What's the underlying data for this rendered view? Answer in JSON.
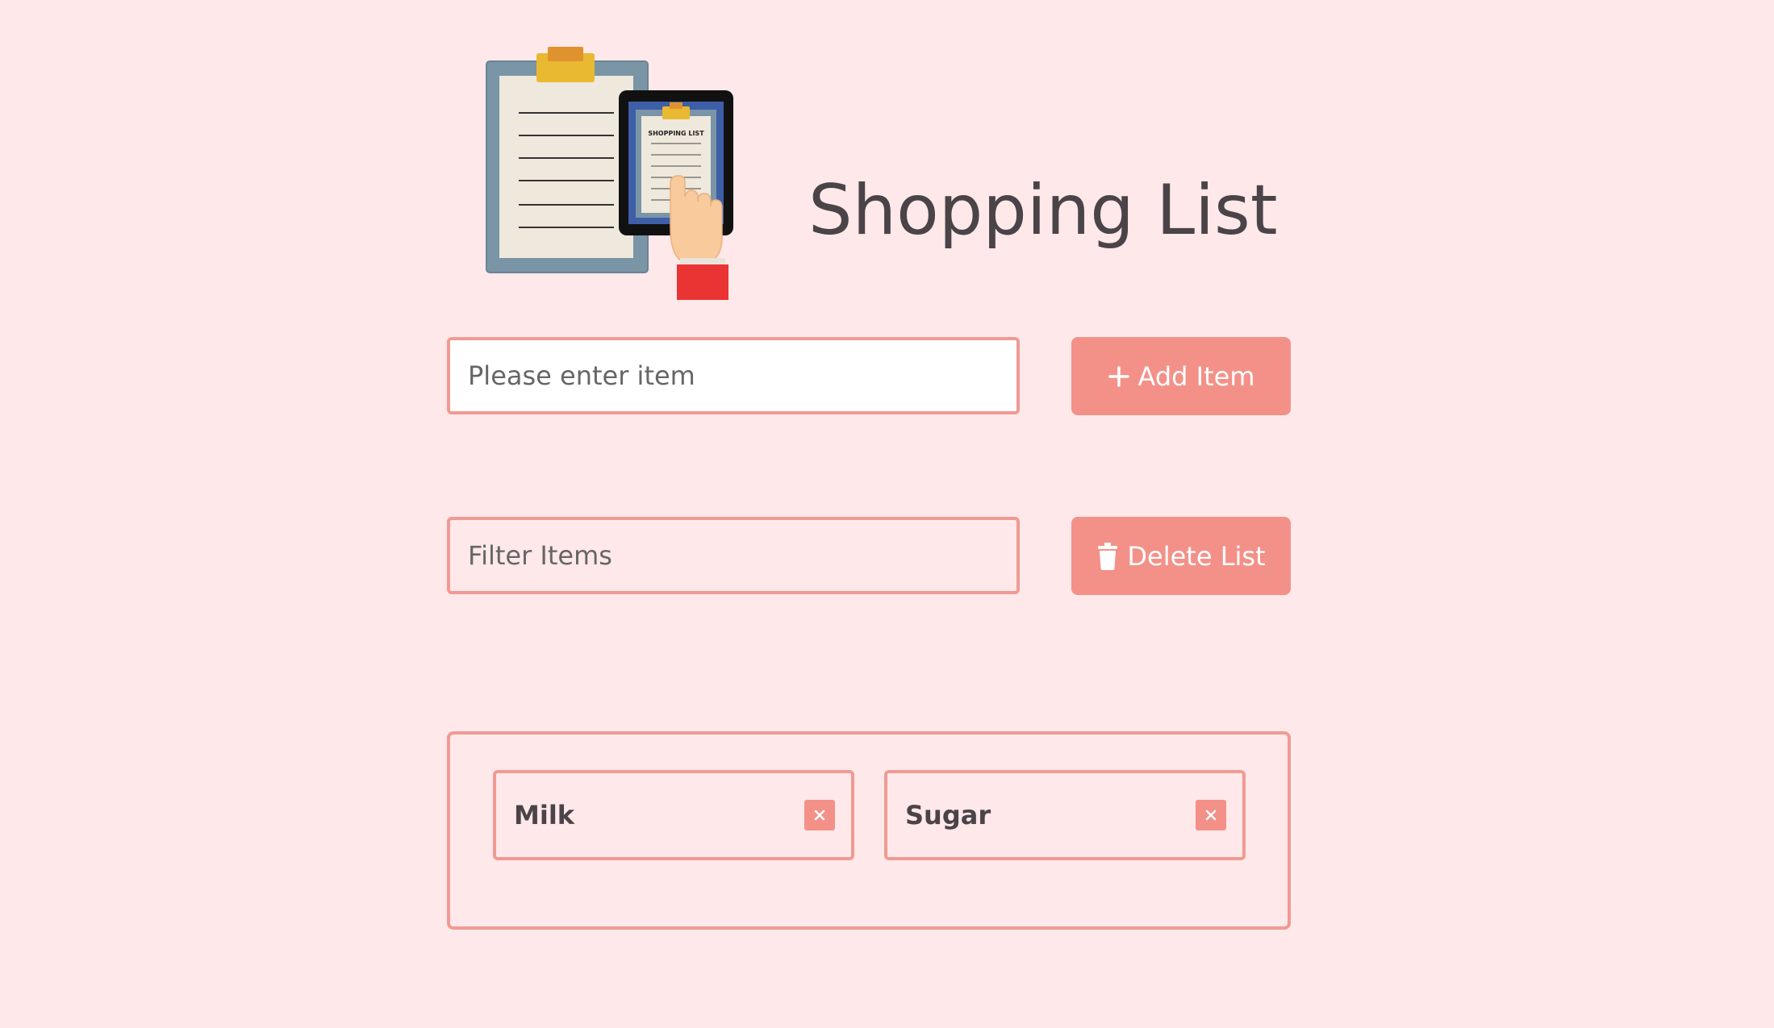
{
  "header": {
    "title": "Shopping List",
    "logo_icon": "clipboard-tablet-shopping-list-illustration",
    "logo_text": "SHOPPING LIST"
  },
  "add_form": {
    "input_placeholder": "Please enter item",
    "input_value": "",
    "button_icon": "plus-icon",
    "button_label": "Add Item"
  },
  "filter": {
    "input_placeholder": "Filter Items",
    "input_value": "",
    "button_icon": "trash-icon",
    "button_label": "Delete List"
  },
  "list": {
    "items": [
      {
        "label": "Milk",
        "remove_icon": "close-icon"
      },
      {
        "label": "Sugar",
        "remove_icon": "close-icon"
      }
    ]
  },
  "colors": {
    "background": "#ffe8e9",
    "accent": "#f39189",
    "border": "#f09a93",
    "text": "#4a4448"
  }
}
